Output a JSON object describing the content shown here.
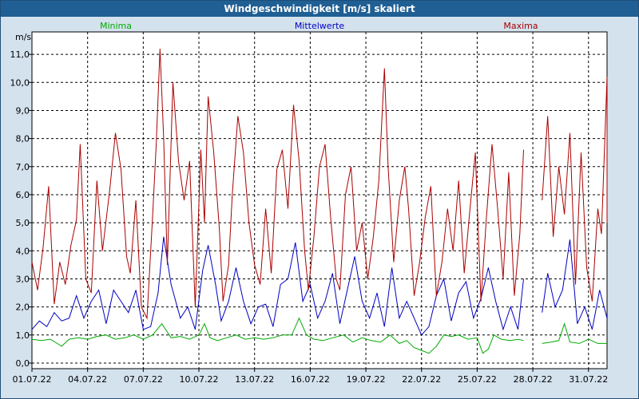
{
  "window": {
    "title": "Windgeschwindigkeit [m/s] skaliert"
  },
  "colors": {
    "min": "#00aa00",
    "mean": "#0000c0",
    "max": "#aa0000",
    "plot_bg": "#ffffff",
    "grid": "#000000",
    "title_bg": "#1f5f94"
  },
  "chart_data": {
    "type": "line",
    "title": "Windgeschwindigkeit [m/s] skaliert",
    "ylabel": "m/s",
    "xlabel": "",
    "ylim": [
      -0.2,
      11.8
    ],
    "yticks": [
      0,
      1,
      2,
      3,
      4,
      5,
      6,
      7,
      8,
      9,
      10,
      11
    ],
    "ytick_labels": [
      "0,0",
      "1,0",
      "2,0",
      "3,0",
      "4,0",
      "5,0",
      "6,0",
      "7,0",
      "8,0",
      "9,0",
      "10,0",
      "11,0"
    ],
    "xlim": [
      0,
      31
    ],
    "xticks": [
      0,
      3,
      6,
      9,
      12,
      15,
      18,
      21,
      24,
      27,
      30
    ],
    "xtick_labels": [
      "01.07.22",
      "04.07.22",
      "07.07.22",
      "10.07.22",
      "13.07.22",
      "16.07.22",
      "19.07.22",
      "22.07.22",
      "25.07.22",
      "28.07.22",
      "31.07.22"
    ],
    "grid": true,
    "legend_position": "top",
    "series": [
      {
        "name": "Minima",
        "segments": [
          [
            [
              0,
              0.85
            ],
            [
              0.5,
              0.8
            ],
            [
              1,
              0.85
            ],
            [
              1.6,
              0.6
            ],
            [
              2,
              0.85
            ],
            [
              2.5,
              0.9
            ],
            [
              3,
              0.85
            ],
            [
              3.5,
              0.95
            ],
            [
              4,
              1.0
            ],
            [
              4.5,
              0.85
            ],
            [
              5,
              0.9
            ],
            [
              5.5,
              1.0
            ],
            [
              6,
              0.85
            ],
            [
              6.5,
              1.0
            ],
            [
              7,
              1.4
            ],
            [
              7.5,
              0.9
            ],
            [
              8,
              0.95
            ],
            [
              8.5,
              0.85
            ],
            [
              9,
              1.0
            ],
            [
              9.3,
              1.4
            ],
            [
              9.6,
              0.9
            ],
            [
              10,
              0.8
            ],
            [
              10.5,
              0.9
            ],
            [
              11,
              1.0
            ],
            [
              11.5,
              0.85
            ],
            [
              12,
              0.9
            ],
            [
              12.5,
              0.85
            ],
            [
              13,
              0.9
            ],
            [
              13.5,
              1.0
            ],
            [
              14,
              1.0
            ],
            [
              14.4,
              1.6
            ],
            [
              14.8,
              1.0
            ],
            [
              15.2,
              0.85
            ],
            [
              15.7,
              0.8
            ],
            [
              16.2,
              0.9
            ],
            [
              16.8,
              1.0
            ],
            [
              17.3,
              0.75
            ],
            [
              17.8,
              0.9
            ],
            [
              18.3,
              0.8
            ],
            [
              18.8,
              0.75
            ],
            [
              19.3,
              1.0
            ],
            [
              19.8,
              0.7
            ],
            [
              20.2,
              0.8
            ],
            [
              20.6,
              0.55
            ],
            [
              21,
              0.45
            ],
            [
              21.4,
              0.35
            ],
            [
              21.8,
              0.6
            ],
            [
              22.2,
              1.0
            ],
            [
              22.6,
              0.95
            ],
            [
              23,
              1.0
            ],
            [
              23.5,
              0.85
            ],
            [
              24,
              0.9
            ],
            [
              24.3,
              0.35
            ],
            [
              24.6,
              0.5
            ],
            [
              24.9,
              1.0
            ],
            [
              25.3,
              0.85
            ],
            [
              25.8,
              0.8
            ],
            [
              26.2,
              0.85
            ],
            [
              26.5,
              0.8
            ]
          ],
          [
            [
              27.5,
              0.7
            ],
            [
              28,
              0.75
            ],
            [
              28.4,
              0.8
            ],
            [
              28.7,
              1.4
            ],
            [
              29,
              0.75
            ],
            [
              29.5,
              0.7
            ],
            [
              30,
              0.85
            ],
            [
              30.5,
              0.7
            ],
            [
              31,
              0.7
            ]
          ]
        ]
      },
      {
        "name": "Mittelwerte",
        "segments": [
          [
            [
              0,
              1.2
            ],
            [
              0.4,
              1.5
            ],
            [
              0.8,
              1.3
            ],
            [
              1.2,
              1.8
            ],
            [
              1.6,
              1.5
            ],
            [
              2,
              1.6
            ],
            [
              2.4,
              2.4
            ],
            [
              2.8,
              1.6
            ],
            [
              3.2,
              2.2
            ],
            [
              3.6,
              2.6
            ],
            [
              4,
              1.4
            ],
            [
              4.4,
              2.6
            ],
            [
              4.8,
              2.2
            ],
            [
              5.2,
              1.8
            ],
            [
              5.6,
              2.6
            ],
            [
              6,
              1.2
            ],
            [
              6.4,
              1.3
            ],
            [
              6.8,
              2.5
            ],
            [
              7.1,
              4.5
            ],
            [
              7.5,
              2.8
            ],
            [
              8,
              1.6
            ],
            [
              8.4,
              2.0
            ],
            [
              8.8,
              1.2
            ],
            [
              9.2,
              3.3
            ],
            [
              9.5,
              4.2
            ],
            [
              9.9,
              2.8
            ],
            [
              10.2,
              1.5
            ],
            [
              10.6,
              2.2
            ],
            [
              11,
              3.4
            ],
            [
              11.4,
              2.2
            ],
            [
              11.8,
              1.4
            ],
            [
              12.2,
              2.0
            ],
            [
              12.6,
              2.1
            ],
            [
              13,
              1.3
            ],
            [
              13.4,
              2.8
            ],
            [
              13.8,
              3.0
            ],
            [
              14.2,
              4.3
            ],
            [
              14.6,
              2.2
            ],
            [
              15,
              2.8
            ],
            [
              15.4,
              1.6
            ],
            [
              15.8,
              2.2
            ],
            [
              16.2,
              3.2
            ],
            [
              16.6,
              1.4
            ],
            [
              17,
              2.6
            ],
            [
              17.4,
              3.8
            ],
            [
              17.8,
              2.2
            ],
            [
              18.2,
              1.6
            ],
            [
              18.6,
              2.5
            ],
            [
              19,
              1.3
            ],
            [
              19.4,
              3.4
            ],
            [
              19.8,
              1.6
            ],
            [
              20.2,
              2.2
            ],
            [
              20.6,
              1.6
            ],
            [
              21,
              1.0
            ],
            [
              21.4,
              1.3
            ],
            [
              21.8,
              2.4
            ],
            [
              22.2,
              3.0
            ],
            [
              22.6,
              1.5
            ],
            [
              23,
              2.5
            ],
            [
              23.4,
              2.9
            ],
            [
              23.8,
              1.6
            ],
            [
              24.2,
              2.3
            ],
            [
              24.6,
              3.4
            ],
            [
              25,
              2.2
            ],
            [
              25.4,
              1.2
            ],
            [
              25.8,
              2.0
            ],
            [
              26.2,
              1.2
            ],
            [
              26.5,
              3.0
            ]
          ],
          [
            [
              27.5,
              1.8
            ],
            [
              27.8,
              3.2
            ],
            [
              28.2,
              2.0
            ],
            [
              28.6,
              2.6
            ],
            [
              29,
              4.4
            ],
            [
              29.4,
              1.4
            ],
            [
              29.8,
              2.0
            ],
            [
              30.2,
              1.2
            ],
            [
              30.6,
              2.6
            ],
            [
              31,
              1.6
            ]
          ]
        ]
      },
      {
        "name": "Maxima",
        "segments": [
          [
            [
              0,
              3.6
            ],
            [
              0.3,
              2.6
            ],
            [
              0.6,
              4.1
            ],
            [
              0.9,
              6.3
            ],
            [
              1.2,
              2.1
            ],
            [
              1.5,
              3.6
            ],
            [
              1.8,
              2.8
            ],
            [
              2.1,
              4.2
            ],
            [
              2.4,
              5.1
            ],
            [
              2.6,
              7.8
            ],
            [
              2.9,
              3.0
            ],
            [
              3.2,
              2.5
            ],
            [
              3.5,
              6.5
            ],
            [
              3.8,
              4.0
            ],
            [
              4.2,
              6.2
            ],
            [
              4.5,
              8.2
            ],
            [
              4.8,
              6.9
            ],
            [
              5.1,
              3.8
            ],
            [
              5.3,
              3.2
            ],
            [
              5.6,
              5.8
            ],
            [
              5.9,
              2.0
            ],
            [
              6.2,
              1.6
            ],
            [
              6.5,
              5.2
            ],
            [
              6.7,
              7.8
            ],
            [
              6.9,
              11.2
            ],
            [
              7.1,
              8.0
            ],
            [
              7.3,
              3.5
            ],
            [
              7.6,
              10.0
            ],
            [
              7.9,
              7.2
            ],
            [
              8.2,
              5.8
            ],
            [
              8.5,
              7.2
            ],
            [
              8.8,
              2.0
            ],
            [
              9.1,
              7.6
            ],
            [
              9.3,
              5.0
            ],
            [
              9.5,
              9.5
            ],
            [
              9.8,
              7.5
            ],
            [
              10.1,
              4.8
            ],
            [
              10.3,
              2.2
            ],
            [
              10.6,
              3.5
            ],
            [
              10.8,
              6.0
            ],
            [
              11.1,
              8.8
            ],
            [
              11.4,
              7.5
            ],
            [
              11.7,
              5.0
            ],
            [
              12,
              3.5
            ],
            [
              12.3,
              2.8
            ],
            [
              12.6,
              5.5
            ],
            [
              12.9,
              3.2
            ],
            [
              13.2,
              6.9
            ],
            [
              13.5,
              7.6
            ],
            [
              13.8,
              5.5
            ],
            [
              14.1,
              9.2
            ],
            [
              14.4,
              7.2
            ],
            [
              14.7,
              4.0
            ],
            [
              14.9,
              2.6
            ],
            [
              15.2,
              4.5
            ],
            [
              15.5,
              7.0
            ],
            [
              15.8,
              7.8
            ],
            [
              16.1,
              5.2
            ],
            [
              16.4,
              3.0
            ],
            [
              16.6,
              2.6
            ],
            [
              16.9,
              6.0
            ],
            [
              17.2,
              7.0
            ],
            [
              17.5,
              4.0
            ],
            [
              17.8,
              5.0
            ],
            [
              18.1,
              3.0
            ],
            [
              18.4,
              4.5
            ],
            [
              18.7,
              6.5
            ],
            [
              19,
              10.5
            ],
            [
              19.2,
              7.0
            ],
            [
              19.5,
              3.6
            ],
            [
              19.8,
              5.8
            ],
            [
              20.1,
              7.0
            ],
            [
              20.3,
              5.5
            ],
            [
              20.6,
              2.4
            ],
            [
              20.9,
              3.6
            ],
            [
              21.2,
              5.2
            ],
            [
              21.5,
              6.3
            ],
            [
              21.8,
              2.4
            ],
            [
              22.1,
              3.6
            ],
            [
              22.4,
              5.5
            ],
            [
              22.7,
              4.0
            ],
            [
              23,
              6.5
            ],
            [
              23.3,
              3.2
            ],
            [
              23.6,
              5.4
            ],
            [
              23.9,
              7.5
            ],
            [
              24.2,
              2.2
            ],
            [
              24.5,
              5.2
            ],
            [
              24.8,
              7.8
            ],
            [
              25.1,
              5.5
            ],
            [
              25.4,
              3.0
            ],
            [
              25.7,
              6.8
            ],
            [
              26.0,
              2.4
            ],
            [
              26.3,
              4.6
            ],
            [
              26.5,
              7.6
            ]
          ],
          [
            [
              27.5,
              5.8
            ],
            [
              27.8,
              8.8
            ],
            [
              28.1,
              4.5
            ],
            [
              28.4,
              7.0
            ],
            [
              28.7,
              5.3
            ],
            [
              29,
              8.2
            ],
            [
              29.3,
              2.8
            ],
            [
              29.6,
              7.5
            ],
            [
              29.9,
              3.4
            ],
            [
              30.2,
              2.2
            ],
            [
              30.5,
              5.5
            ],
            [
              30.7,
              4.6
            ],
            [
              31,
              10.2
            ],
            [
              31,
              5.0
            ]
          ]
        ]
      }
    ]
  }
}
